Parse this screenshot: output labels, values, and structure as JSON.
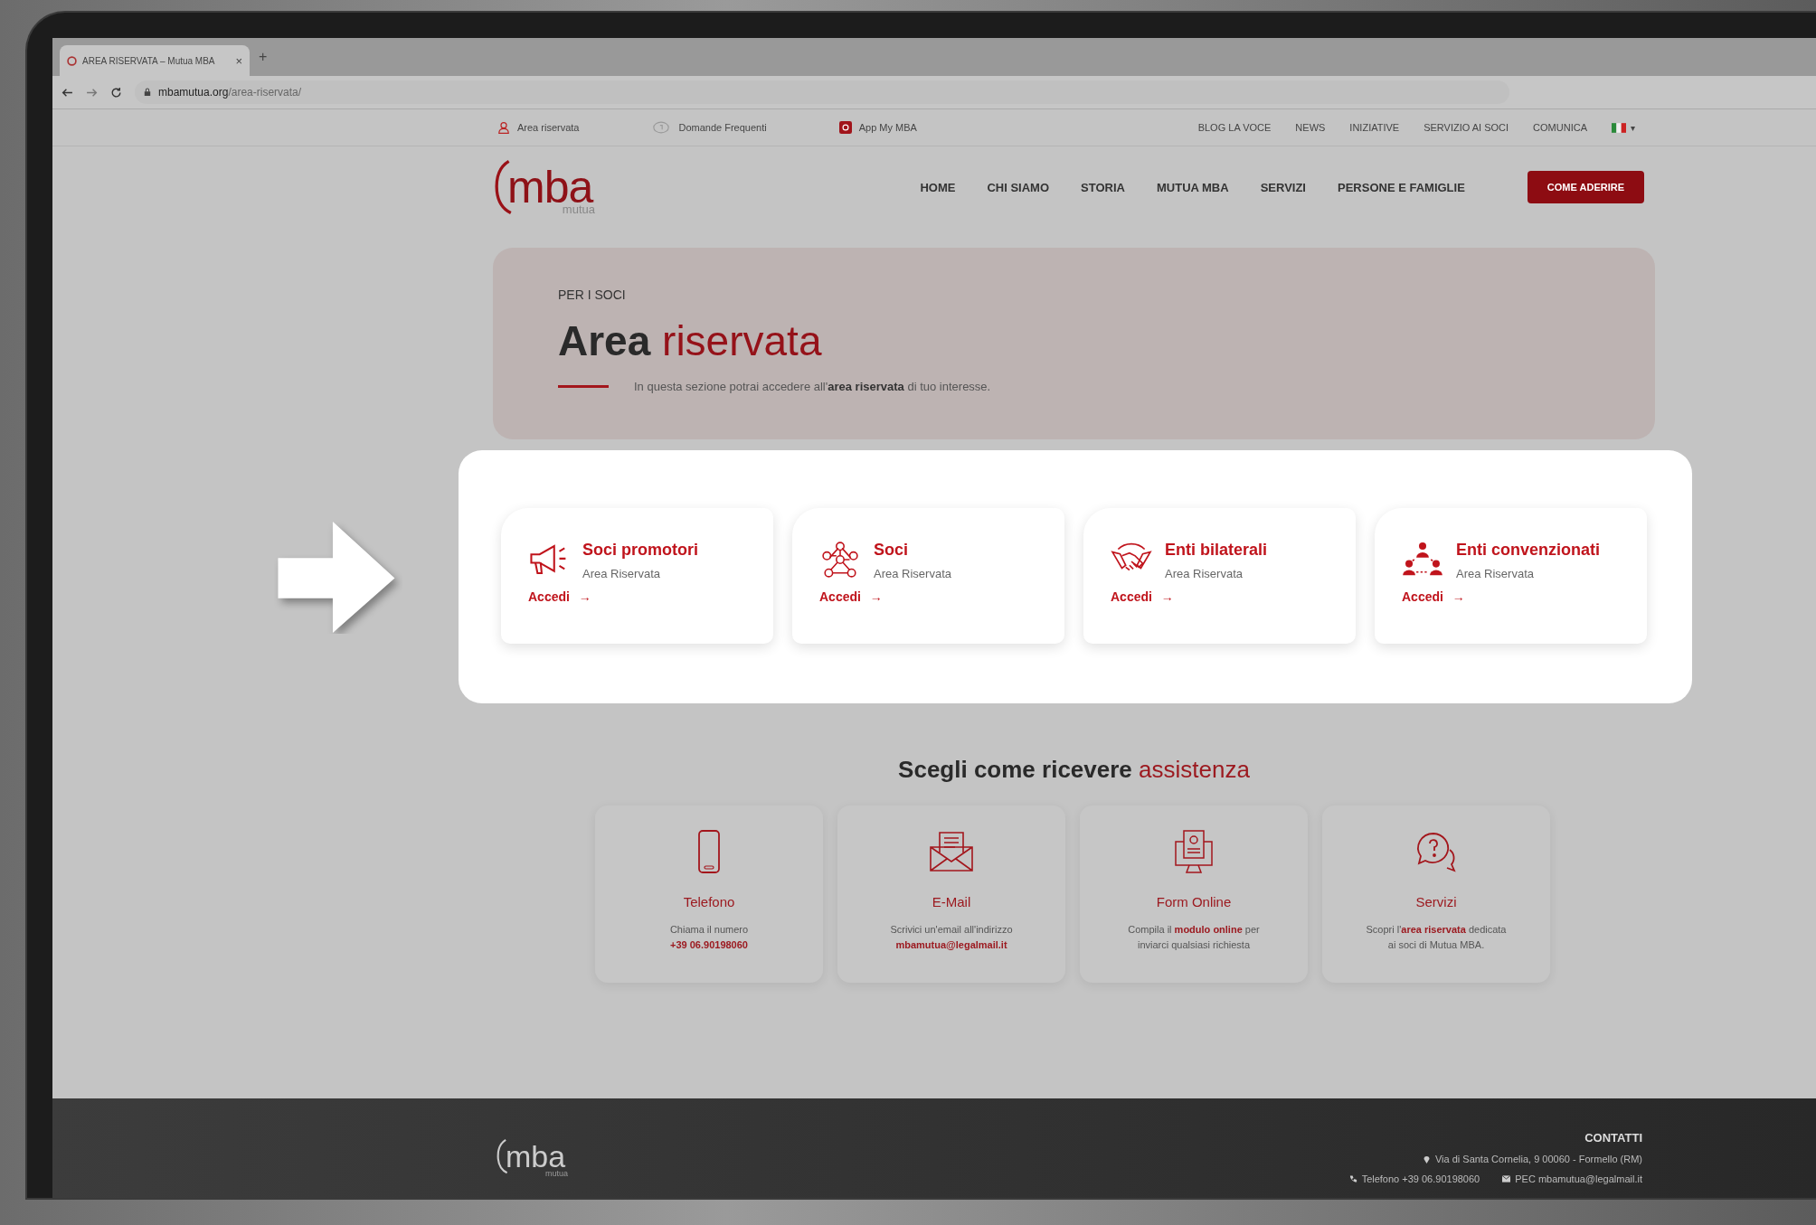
{
  "browser": {
    "tab_title": "AREA RISERVATA – Mutua MBA",
    "tab_close": "×",
    "new_tab": "+",
    "url_host": "mbamutua.org",
    "url_path": "/area-riservata/"
  },
  "utility_bar": {
    "left": [
      {
        "kind": "user",
        "label": "Area riservata"
      },
      {
        "kind": "faq",
        "label": "Domande Frequenti"
      },
      {
        "kind": "app",
        "label": "App My MBA"
      }
    ],
    "right": [
      "BLOG LA VOCE",
      "NEWS",
      "INIZIATIVE",
      "SERVIZIO AI SOCI",
      "COMUNICA"
    ],
    "language_caret": "▾"
  },
  "logo": {
    "text": "mba",
    "sub": "mutua"
  },
  "nav": {
    "items": [
      "HOME",
      "CHI SIAMO",
      "STORIA",
      "MUTUA MBA",
      "SERVIZI",
      "PERSONE E FAMIGLIE"
    ],
    "cta": "COME ADERIRE"
  },
  "hero": {
    "eyebrow": "PER I SOCI",
    "title_bold": "Area",
    "title_accent": "riservata",
    "intro": "In questa sezione potrai accedere all'**area riservata** di tuo interesse."
  },
  "areas": [
    {
      "kind": "megaphone",
      "title": "Soci promotori",
      "subtitle": "Area Riservata",
      "link": "Accedi",
      "arrow": "→"
    },
    {
      "kind": "network",
      "title": "Soci",
      "subtitle": "Area Riservata",
      "link": "Accedi",
      "arrow": "→"
    },
    {
      "kind": "handshake",
      "title": "Enti bilaterali",
      "subtitle": "Area Riservata",
      "link": "Accedi",
      "arrow": "→"
    },
    {
      "kind": "people",
      "title": "Enti convenzionati",
      "subtitle": "Area Riservata",
      "link": "Accedi",
      "arrow": "→"
    }
  ],
  "assistance": {
    "title_bold": "Scegli come ricevere",
    "title_accent": "assistenza",
    "channels": [
      {
        "kind": "phone",
        "title": "Telefono",
        "lines": [
          "Chiama il numero",
          "**+39 06.90198060**"
        ]
      },
      {
        "kind": "email",
        "title": "E-Mail",
        "lines": [
          "Scrivici un'email all'indirizzo",
          "**mbamutua@legalmail.it**"
        ]
      },
      {
        "kind": "form",
        "title": "Form Online",
        "lines": [
          "Compila il **modulo online** per",
          "inviarci qualsiasi richiesta"
        ]
      },
      {
        "kind": "help",
        "title": "Servizi",
        "lines": [
          "Scopri l'**area riservata** dedicata",
          "ai soci di Mutua MBA."
        ]
      }
    ]
  },
  "footer": {
    "logo_text": "mba",
    "logo_sub": "mutua",
    "heading": "CONTATTI",
    "address": "Via di Santa Cornelia, 9 00060 - Formello (RM)",
    "phone": "Telefono +39 06.90198060",
    "pec": "PEC mbamutua@legalmail.it"
  }
}
